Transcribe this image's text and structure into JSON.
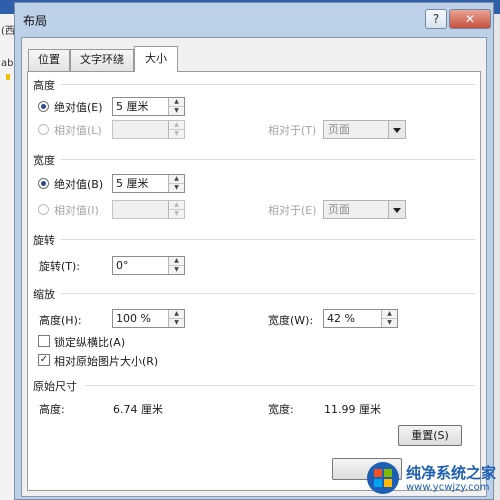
{
  "background": {
    "left_fragments": [
      "(西",
      "ab"
    ]
  },
  "dialog": {
    "title": "布局",
    "help_label": "?",
    "close_label": "✕",
    "tabs": [
      {
        "label": "位置",
        "active": false
      },
      {
        "label": "文字环绕",
        "active": false
      },
      {
        "label": "大小",
        "active": true
      }
    ],
    "height_group": {
      "title": "高度",
      "absolute": {
        "label": "绝对值(E)",
        "value": "5 厘米",
        "selected": true
      },
      "relative": {
        "label": "相对值(L)",
        "value": "",
        "selected": false,
        "disabled": true
      },
      "relative_to_label": "相对于(T)",
      "relative_to_value": "页面"
    },
    "width_group": {
      "title": "宽度",
      "absolute": {
        "label": "绝对值(B)",
        "value": "5 厘米",
        "selected": true
      },
      "relative": {
        "label": "相对值(I)",
        "value": "",
        "selected": false,
        "disabled": true
      },
      "relative_to_label": "相对于(E)",
      "relative_to_value": "页面"
    },
    "rotate_group": {
      "title": "旋转",
      "label": "旋转(T):",
      "value": "0°"
    },
    "scale_group": {
      "title": "缩放",
      "height_label": "高度(H):",
      "height_value": "100 %",
      "width_label": "宽度(W):",
      "width_value": "42 %",
      "lock_aspect": {
        "label": "锁定纵横比(A)",
        "checked": false
      },
      "relative_original": {
        "label": "相对原始图片大小(R)",
        "checked": true
      }
    },
    "original_size": {
      "title": "原始尺寸",
      "height_label": "高度:",
      "height_value": "6.74 厘米",
      "width_label": "宽度:",
      "width_value": "11.99 厘米"
    },
    "reset_label": "重置(S)"
  },
  "watermark": {
    "name": "纯净系统之家",
    "url": "www.ycwjzy.com"
  },
  "colors": {
    "frame": "#bcd0e7",
    "ribbon": "#2e5fa8",
    "accent": "#1d5fb4",
    "close": "#c8503d"
  }
}
